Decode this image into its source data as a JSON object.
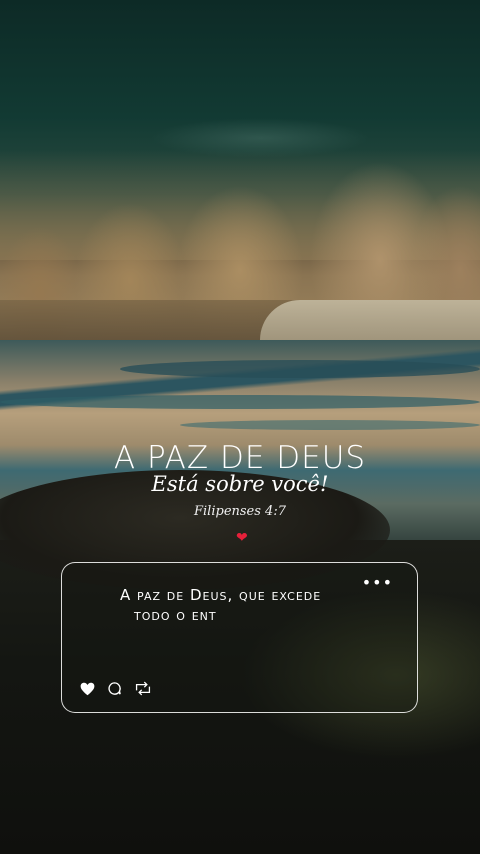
{
  "post": {
    "title": "A PAZ DE DEUS",
    "subtitle": "Está sobre você!",
    "reference": "Filipenses 4:7",
    "heart_emoji": "❤"
  },
  "card": {
    "menu": "•••",
    "text_line1": "A paz de Deus, que excede",
    "text_line2": "todo o ent",
    "icons": {
      "like": "heart-icon",
      "comment": "comment-icon",
      "repost": "repost-icon"
    }
  },
  "colors": {
    "text": "#ffffff",
    "heart": "#e6203a"
  }
}
